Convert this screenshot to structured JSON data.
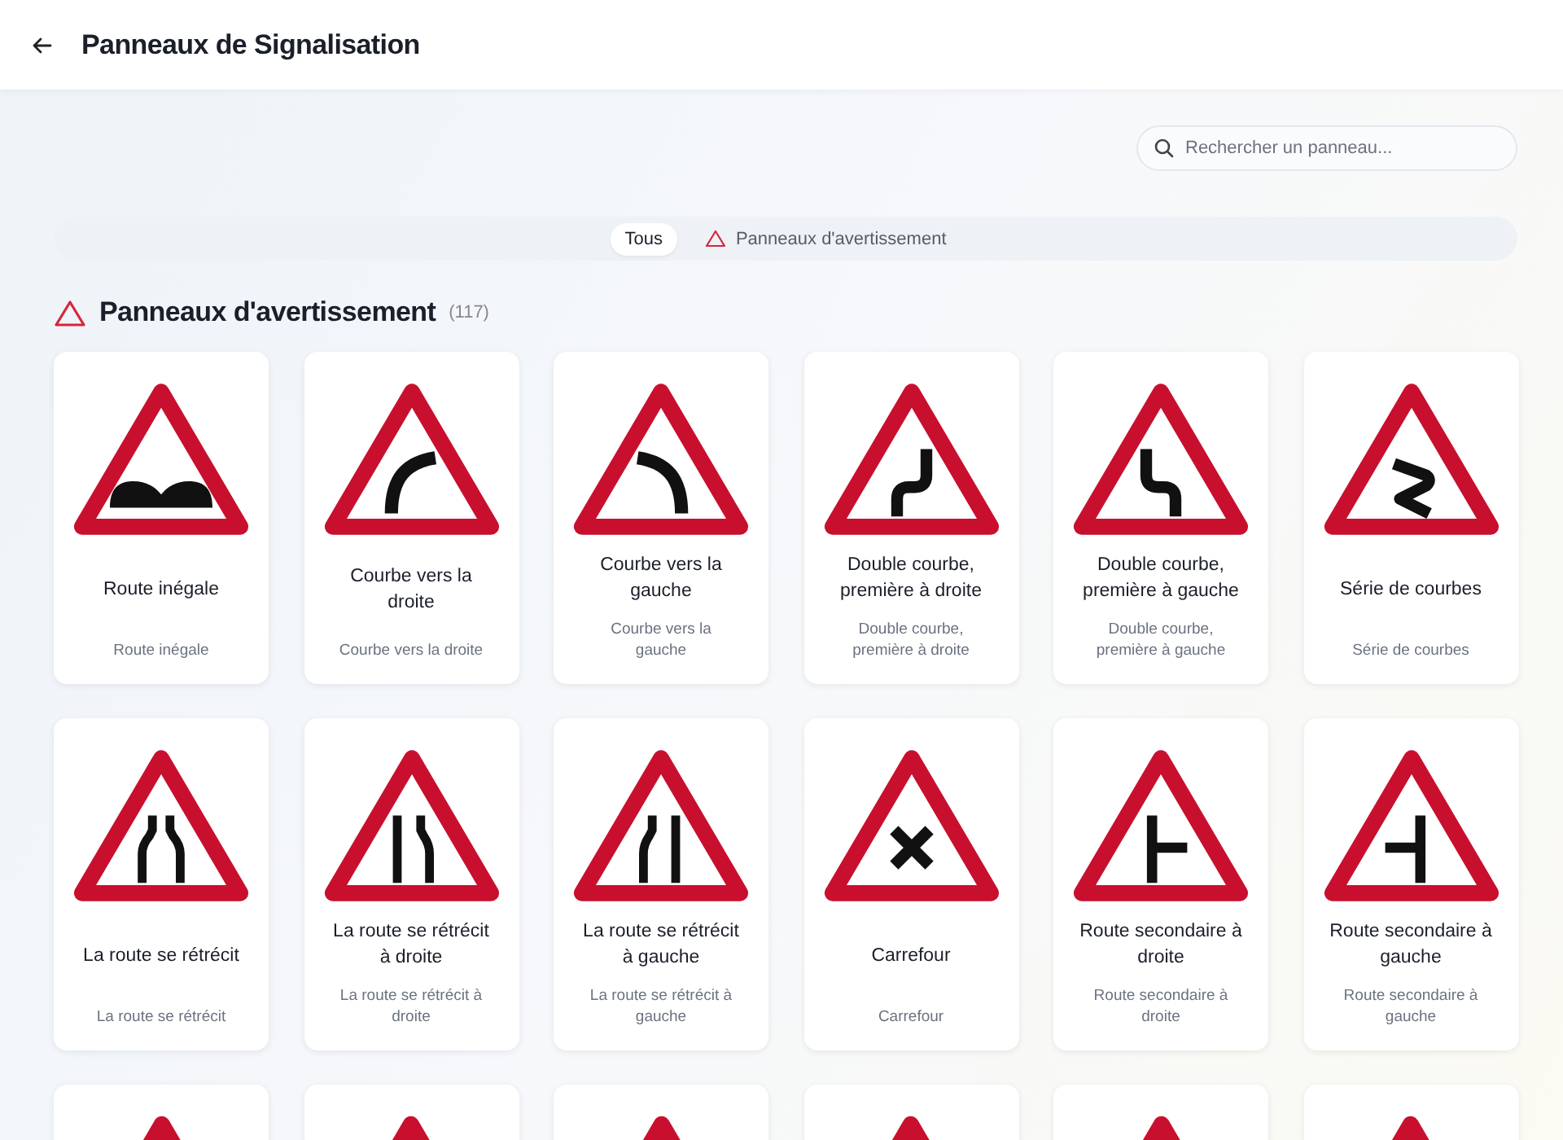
{
  "header": {
    "title": "Panneaux de Signalisation"
  },
  "search": {
    "placeholder": "Rechercher un panneau..."
  },
  "filters": [
    {
      "label": "Tous",
      "selected": true,
      "kind": "plain"
    },
    {
      "label": "Panneaux d'avertissement",
      "selected": false,
      "kind": "warning"
    }
  ],
  "section": {
    "title": "Panneaux d'avertissement",
    "count": "(117)"
  },
  "cards": [
    {
      "title": "Route inégale",
      "subtitle": "Route inégale",
      "kind": "bumps"
    },
    {
      "title": "Courbe vers la droite",
      "subtitle": "Courbe vers la droite",
      "kind": "curve_right"
    },
    {
      "title": "Courbe vers la gauche",
      "subtitle": "Courbe vers la gauche",
      "kind": "curve_left"
    },
    {
      "title": "Double courbe, première à droite",
      "subtitle": "Double courbe, première à droite",
      "kind": "double_right"
    },
    {
      "title": "Double courbe, première à gauche",
      "subtitle": "Double courbe, première à gauche",
      "kind": "double_left"
    },
    {
      "title": "Série de courbes",
      "subtitle": "Série de courbes",
      "kind": "series"
    },
    {
      "title": "La route se rétrécit",
      "subtitle": "La route se rétrécit",
      "kind": "narrow_both"
    },
    {
      "title": "La route se rétrécit à droite",
      "subtitle": "La route se rétrécit à droite",
      "kind": "narrow_right"
    },
    {
      "title": "La route se rétrécit à gauche",
      "subtitle": "La route se rétrécit à gauche",
      "kind": "narrow_left"
    },
    {
      "title": "Carrefour",
      "subtitle": "Carrefour",
      "kind": "crossroads"
    },
    {
      "title": "Route secondaire à droite",
      "subtitle": "Route secondaire à droite",
      "kind": "side_right"
    },
    {
      "title": "Route secondaire à gauche",
      "subtitle": "Route secondaire à gauche",
      "kind": "side_left"
    },
    {
      "kind": "hidden"
    },
    {
      "kind": "hidden"
    },
    {
      "kind": "hidden"
    },
    {
      "kind": "hidden"
    },
    {
      "kind": "hidden"
    },
    {
      "kind": "hidden"
    }
  ]
}
